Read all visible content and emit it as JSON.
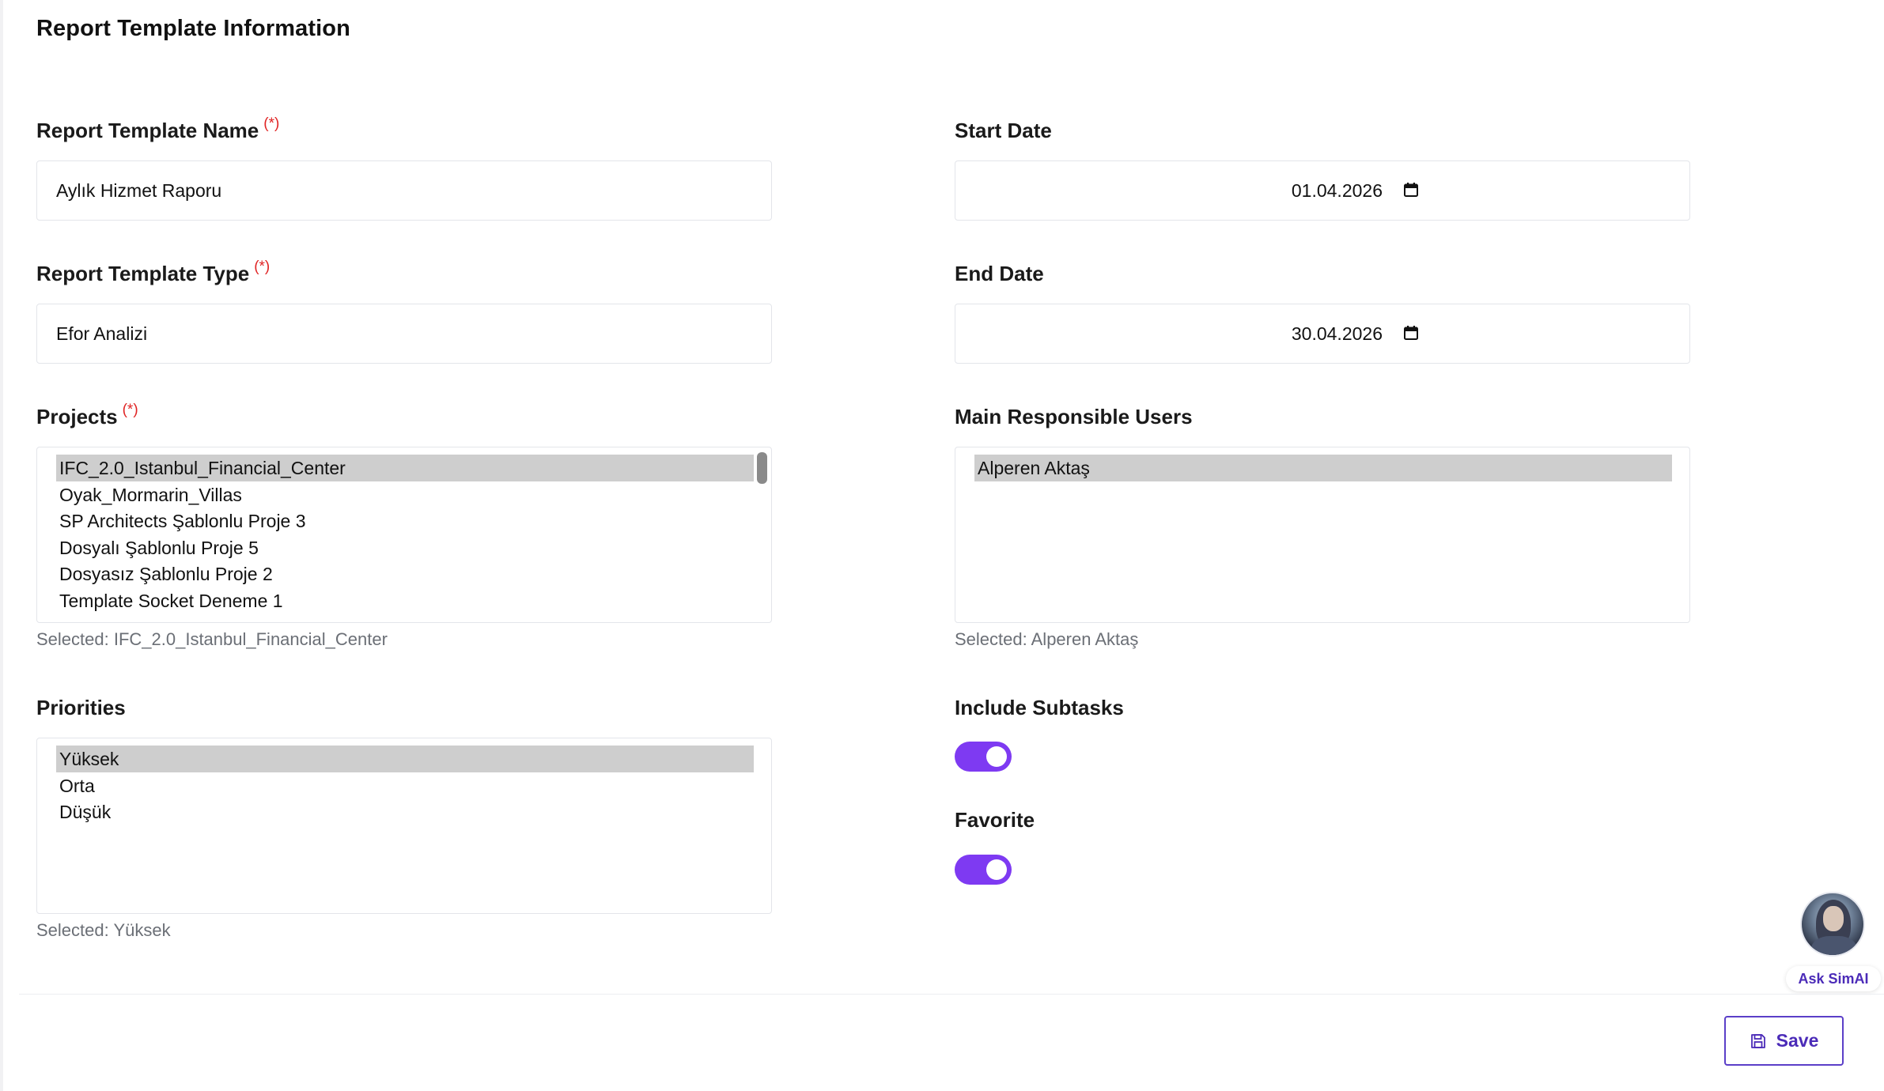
{
  "section": {
    "title": "Report Template Information"
  },
  "fields": {
    "name": {
      "label": "Report Template Name",
      "required_mark": "(*)",
      "value": "Aylık Hizmet Raporu"
    },
    "type": {
      "label": "Report Template Type",
      "required_mark": "(*)",
      "value": "Efor Analizi"
    },
    "start_date": {
      "label": "Start Date",
      "value": "01.04.2026"
    },
    "end_date": {
      "label": "End Date",
      "value": "30.04.2026"
    },
    "projects": {
      "label": "Projects",
      "required_mark": "(*)",
      "options": [
        "IFC_2.0_Istanbul_Financial_Center",
        "Oyak_Mormarin_Villas",
        "SP Architects Şablonlu Proje 3",
        "Dosyalı Şablonlu Proje 5",
        "Dosyasız Şablonlu Proje 2",
        "Template Socket Deneme 1"
      ],
      "selected_text": "Selected: IFC_2.0_Istanbul_Financial_Center"
    },
    "main_responsible_users": {
      "label": "Main Responsible Users",
      "options": [
        "Alperen Aktaş"
      ],
      "selected_text": "Selected: Alperen Aktaş"
    },
    "priorities": {
      "label": "Priorities",
      "options": [
        "Yüksek",
        "Orta",
        "Düşük"
      ],
      "selected_text": "Selected: Yüksek"
    },
    "include_subtasks": {
      "label": "Include Subtasks",
      "checked": true
    },
    "favorite": {
      "label": "Favorite",
      "checked": true
    }
  },
  "actions": {
    "save_label": "Save"
  },
  "assistant": {
    "label": "Ask SimAI"
  },
  "colors": {
    "accent": "#7e3af2",
    "required": "#e02424",
    "save_border": "#5b3fc8",
    "selected_row": "#cecece"
  }
}
